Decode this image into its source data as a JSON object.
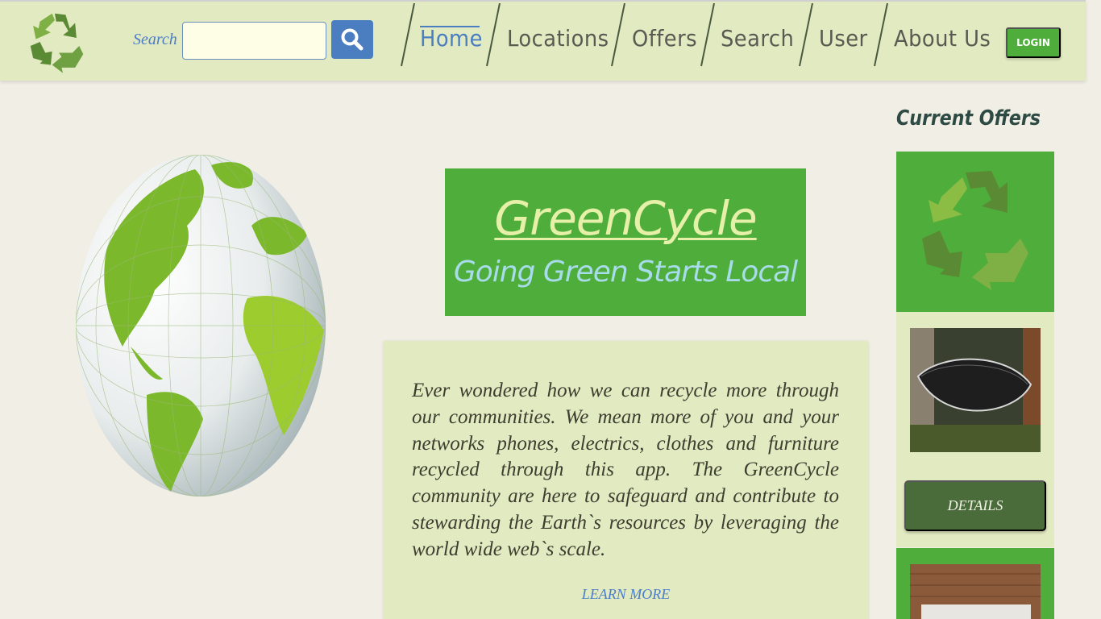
{
  "header": {
    "search_label": "Search",
    "search_placeholder": "",
    "nav": [
      {
        "label": "Home",
        "active": true
      },
      {
        "label": "Locations"
      },
      {
        "label": "Offers"
      },
      {
        "label": "Search"
      },
      {
        "label": "User"
      },
      {
        "label": "About Us"
      }
    ],
    "login_label": "LOGIN"
  },
  "hero": {
    "title": "GreenCycle",
    "subtitle": "Going Green Starts Local"
  },
  "intro": {
    "text": "Ever wondered how we can recycle more through our communities. We mean more of you and your networks phones, electrics, clothes and furniture recycled through this app. The GreenCycle community are here to safeguard and contribute to stewarding the Earth`s resources by leveraging the world wide web`s scale.",
    "learn_more": "LEARN MORE"
  },
  "sidebar": {
    "heading": "Current Offers",
    "details_label": "DETAILS"
  },
  "colors": {
    "accent_green": "#4fae3b",
    "header_bg": "#e2eac1",
    "link_blue": "#4a7ec0",
    "dark_green": "#4a6b3a"
  },
  "icons": [
    "recycle-logo-icon",
    "search-icon",
    "recycle-icon",
    "globe-image"
  ]
}
